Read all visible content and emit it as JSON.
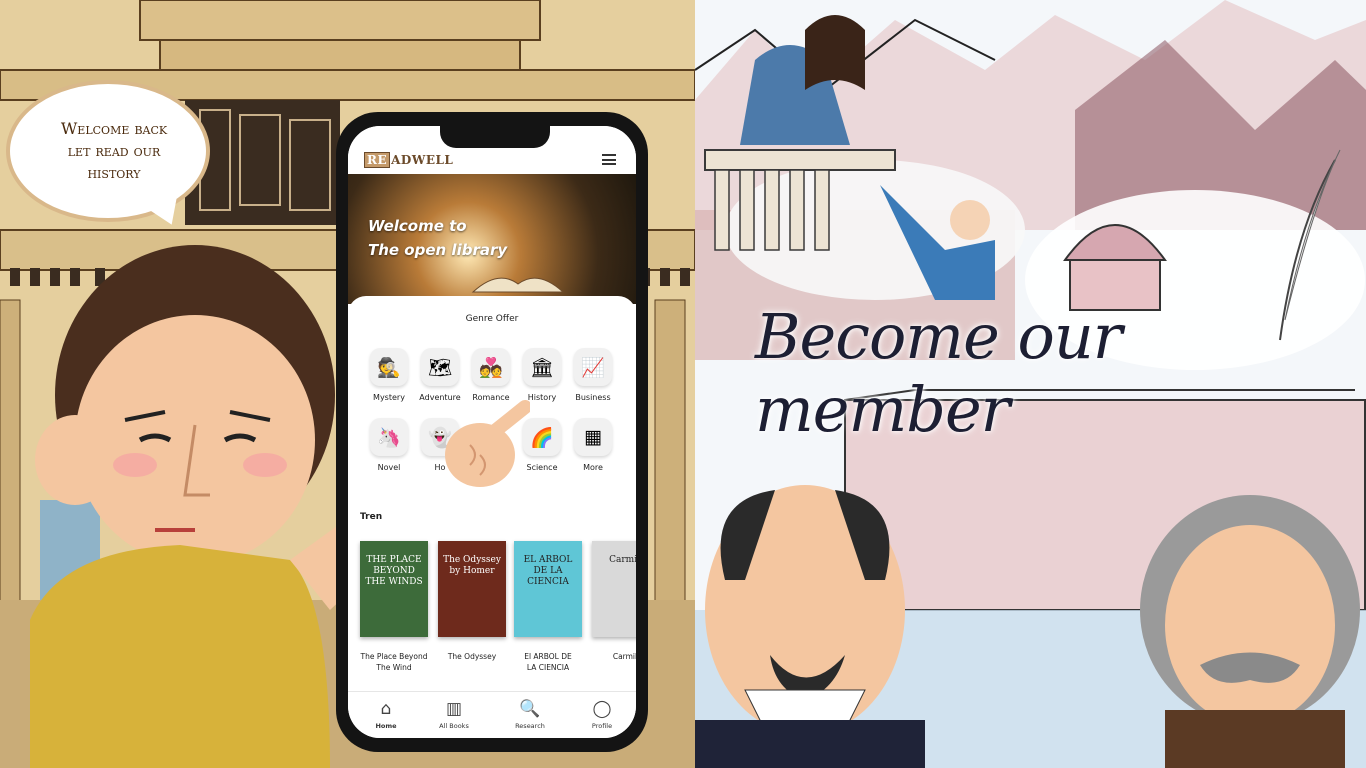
{
  "bubble": {
    "text_line1": "Welcome back",
    "text_line2": "let read our",
    "text_line3": "history"
  },
  "app": {
    "logo_box": "RE",
    "logo_rest": "ADWELL",
    "hero_line1": "Welcome to",
    "hero_line2": "The open library",
    "genre_title": "Genre Offer",
    "genres": [
      {
        "label": "Mystery",
        "icon": "detective-icon",
        "glyph": "🕵"
      },
      {
        "label": "Adventure",
        "icon": "map-icon",
        "glyph": "🗺"
      },
      {
        "label": "Romance",
        "icon": "couple-heart-icon",
        "glyph": "💑"
      },
      {
        "label": "History",
        "icon": "evolution-icon",
        "glyph": "🏛"
      },
      {
        "label": "Business",
        "icon": "growth-chart-icon",
        "glyph": "📈"
      },
      {
        "label": "Novel",
        "icon": "unicorn-icon",
        "glyph": "🦄"
      },
      {
        "label": "Ho",
        "icon": "ghost-icon",
        "glyph": "👻"
      },
      {
        "label": "Science",
        "icon": "rainbow-icon",
        "glyph": "🌈"
      },
      {
        "label": "More",
        "icon": "grid-icon",
        "glyph": "▦"
      }
    ],
    "trending_label": "Tren",
    "books": [
      {
        "title_line1": "The Place Beyond",
        "title_line2": "The Wind",
        "cover_text": "THE PLACE BEYOND THE WINDS",
        "cover_color": "#3d6b3a"
      },
      {
        "title_line1": "The Odyssey",
        "title_line2": "",
        "cover_text": "The Odyssey by Homer",
        "cover_color": "#6e2a1c"
      },
      {
        "title_line1": "El ARBOL DE",
        "title_line2": "LA CIENCIA",
        "cover_text": "EL ARBOL DE LA CIENCIA",
        "cover_color": "#5fc6d6"
      },
      {
        "title_line1": "Carmill",
        "title_line2": "",
        "cover_text": "Carmill",
        "cover_color": "#d9d9d9"
      }
    ],
    "nav": [
      {
        "label": "Home",
        "glyph": "⌂",
        "icon": "home-icon"
      },
      {
        "label": "All Books",
        "glyph": "▥",
        "icon": "books-icon"
      },
      {
        "label": "Research",
        "glyph": "🔍",
        "icon": "research-icon"
      },
      {
        "label": "Profile",
        "glyph": "◯",
        "icon": "profile-icon"
      }
    ]
  },
  "right": {
    "headline": "Become our member"
  },
  "colors": {
    "left_bg": "#e5cf9e",
    "bubble_border": "#d9b88a",
    "headline": "#1d1f33"
  }
}
